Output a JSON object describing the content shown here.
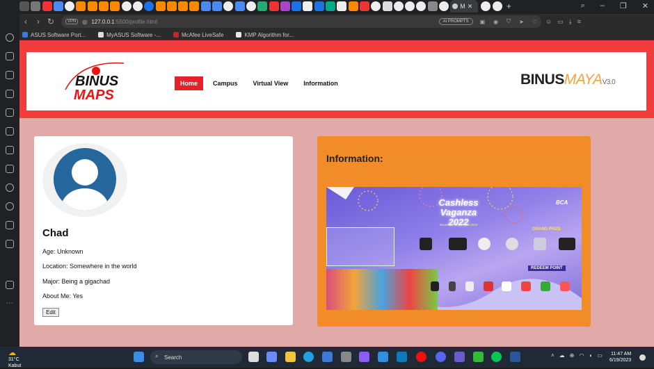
{
  "browser": {
    "active_tab_label": "M",
    "url_host": "127.0.0.1",
    "url_path": ":5500/profile.html",
    "vpn_label": "VPN",
    "ai_prompts_label": "AI PROMPTS",
    "bookmarks": [
      {
        "label": "ASUS Software Port...",
        "color": "#3d7bd8"
      },
      {
        "label": "MyASUS Software -...",
        "color": "#dddddd"
      },
      {
        "label": "McAfee LiveSafe",
        "color": "#c0282b"
      },
      {
        "label": "KMP Algorithm for...",
        "color": "#e8e8e8"
      }
    ]
  },
  "site": {
    "logo_line1": "BINUS",
    "logo_line2": "MAPS",
    "nav": [
      {
        "label": "Home",
        "active": true
      },
      {
        "label": "Campus",
        "active": false
      },
      {
        "label": "Virtual View",
        "active": false
      },
      {
        "label": "Information",
        "active": false
      }
    ],
    "brand_binus": "BINUS",
    "brand_maya": "MAYA",
    "brand_ver": "V3.0"
  },
  "profile": {
    "name": "Chad",
    "age": "Age: Unknown",
    "location": "Location: Somewhere in the world",
    "major": "Major: Being a gigachad",
    "about": "About Me: Yes",
    "edit_label": "Edit"
  },
  "info": {
    "title": "Information:",
    "banner": {
      "heading1": "Cashless",
      "heading2": "Vaganza",
      "year": "2022",
      "dates": "November 2022 - Mei 2023",
      "bank": "BCA",
      "grand_prize": "GRAND PRIZE",
      "redeem": "REDEEM POINT"
    }
  },
  "taskbar": {
    "temp": "31°C",
    "condition": "Kabut",
    "search_label": "Search",
    "time": "11:47 AM",
    "date": "6/19/2023"
  },
  "colors": {
    "header_red": "#f23b3b",
    "nav_active": "#e8202a",
    "page_bg": "#e2a9a9",
    "info_orange": "#f28c28",
    "avatar_blue": "#25679c"
  }
}
